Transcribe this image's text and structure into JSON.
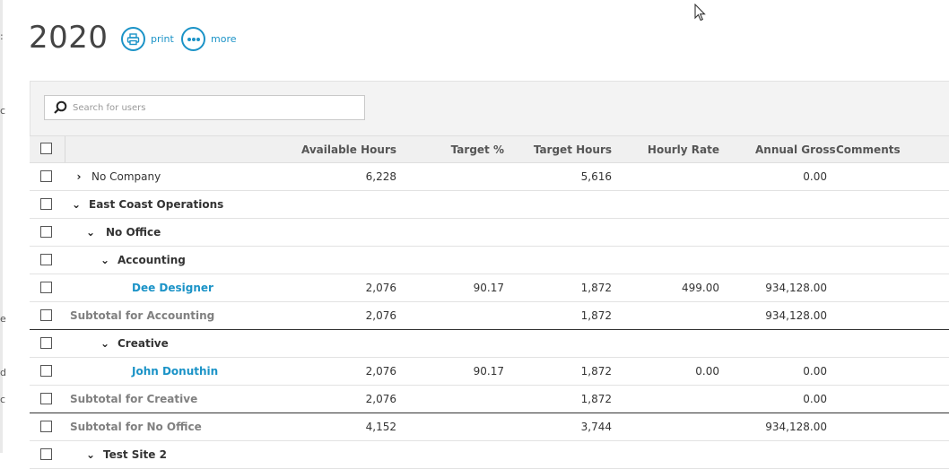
{
  "page": {
    "title": "2020",
    "actions": {
      "print_label": "print",
      "more_label": "more"
    }
  },
  "search": {
    "placeholder": "Search for users"
  },
  "table": {
    "columns": {
      "available_hours": "Available Hours",
      "target_pct": "Target %",
      "target_hours": "Target Hours",
      "hourly_rate": "Hourly Rate",
      "annual_gross": "Annual Gross",
      "comments": "Comments"
    },
    "rows": [
      {
        "name": "No Company",
        "available_hours": "6,228",
        "target_pct": "",
        "target_hours": "5,616",
        "hourly_rate": "",
        "annual_gross": "0.00"
      },
      {
        "name": "East Coast Operations"
      },
      {
        "name": "No Office"
      },
      {
        "name": "Accounting"
      },
      {
        "name": "Dee Designer",
        "available_hours": "2,076",
        "target_pct": "90.17",
        "target_hours": "1,872",
        "hourly_rate": "499.00",
        "annual_gross": "934,128.00"
      },
      {
        "name": "Subtotal for Accounting",
        "available_hours": "2,076",
        "target_pct": "",
        "target_hours": "1,872",
        "hourly_rate": "",
        "annual_gross": "934,128.00"
      },
      {
        "name": "Creative"
      },
      {
        "name": "John Donuthin",
        "available_hours": "2,076",
        "target_pct": "90.17",
        "target_hours": "1,872",
        "hourly_rate": "0.00",
        "annual_gross": "0.00"
      },
      {
        "name": "Subtotal for Creative",
        "available_hours": "2,076",
        "target_pct": "",
        "target_hours": "1,872",
        "hourly_rate": "",
        "annual_gross": "0.00"
      },
      {
        "name": "Subtotal for No Office",
        "available_hours": "4,152",
        "target_pct": "",
        "target_hours": "3,744",
        "hourly_rate": "",
        "annual_gross": "934,128.00"
      },
      {
        "name": "Test Site 2"
      }
    ]
  },
  "colors": {
    "accent": "#1b93c7",
    "header_bg": "#f0f0f0",
    "subtotal_text": "#808080"
  }
}
